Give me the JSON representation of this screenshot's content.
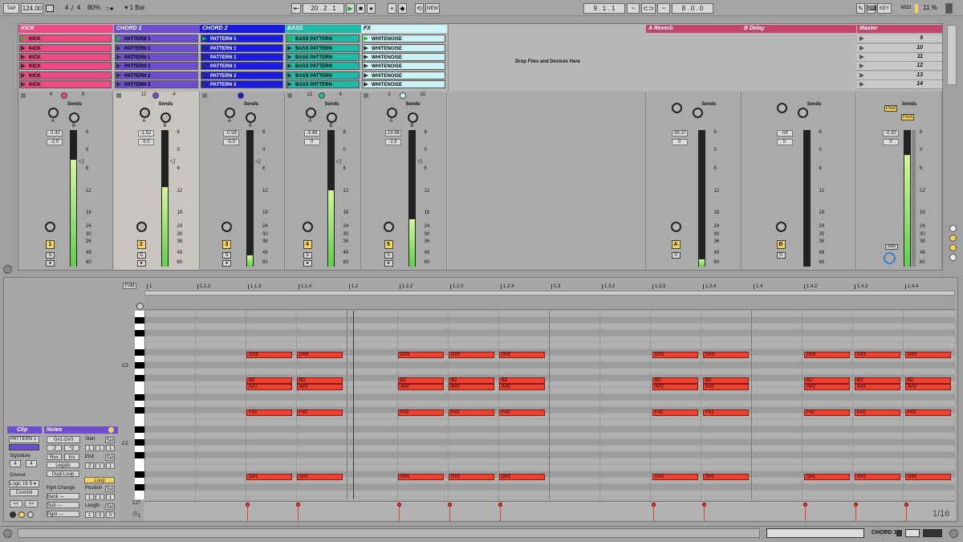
{
  "transport": {
    "tap": "TAP",
    "tempo": "124.00",
    "sig_num": "4",
    "sig_den": "4",
    "zoom": "80%",
    "quant": "1 Bar",
    "position": "20 . 2 . 1",
    "new": "NEW",
    "loop_start": "9 . 1 . 1",
    "loop_len": "8 . 0 . 0",
    "key": "KEY",
    "midi": "MIDI",
    "cpu": "11 %"
  },
  "tracks": [
    {
      "name": "KICK",
      "color": "#f04a86",
      "clips": [
        "KICK",
        "KICK",
        "KICK",
        "KICK",
        "KICK",
        "KICK"
      ],
      "n1": "6",
      "n2": "8",
      "vol": "-3.42",
      "pan": "-2.0",
      "num": "1",
      "meter": 0.78
    },
    {
      "name": "CHORD 1",
      "color": "#6e4ed0",
      "clips": [
        "PATTERN 1",
        "PATTERN 1",
        "PATTERN 1",
        "PATTERN 1",
        "PATTERN 2",
        "PATTERN 2"
      ],
      "n1": "12",
      "n2": "4",
      "vol": "-1.52",
      "pan": "-5.0",
      "num": "2",
      "meter": 0.58
    },
    {
      "name": "CHORD 2",
      "color": "#1a1ae0",
      "clips": [
        "PATTERN 1",
        "PATTERN 1",
        "PATTERN 1",
        "PATTERN 1",
        "PATTERN 2",
        "PATTERN 2"
      ],
      "n1": "",
      "n2": "",
      "vol": "-0.58",
      "pan": "-5.0",
      "num": "3",
      "meter": 0.08
    },
    {
      "name": "BASS",
      "color": "#1fb9a8",
      "clips": [
        "BASS PATTERN",
        "BASS PATTERN",
        "BASS PATTERN",
        "BASS PATTERN",
        "BASS PATTERN",
        "BASS PATTERN"
      ],
      "n1": "12",
      "n2": "4",
      "vol": "-3.48",
      "pan": "0",
      "num": "4",
      "meter": 0.56
    },
    {
      "name": "FX",
      "color": "#cdf3f7",
      "clips": [
        "WHITENOISE",
        "WHITENOISE",
        "WHITENOISE",
        "WHITENOISE",
        "WHITENOISE",
        "WHITENOISE"
      ],
      "n1": "2",
      "n2": "32",
      "vol": "-19.66",
      "pan": "-2.5",
      "num": "5",
      "meter": 0.35
    }
  ],
  "drop_zone": "Drop Files and Devices Here",
  "returns": [
    {
      "name": "A Reverb",
      "vol": "-39.37",
      "pan": "0",
      "num": "A",
      "meter": 0.05
    },
    {
      "name": "B Delay",
      "vol": "-Inf",
      "pan": "0",
      "num": "B",
      "meter": 0.0
    }
  ],
  "master": {
    "name": "Master",
    "scenes": [
      "9",
      "10",
      "11",
      "12",
      "13",
      "14"
    ],
    "vol": "-0.30",
    "pan": "0",
    "post1": "Post",
    "post2": "Post",
    "solo": "Solo",
    "meter": 0.82
  },
  "sends_label": "Sends",
  "send_a": "A",
  "send_b": "B",
  "s_label": "S",
  "meter_ticks": [
    "6",
    "0",
    "6",
    "12",
    "18",
    "24",
    "30",
    "36",
    "48",
    "60"
  ],
  "clip_panel": {
    "title": "Clip",
    "name": "PATTERN 1",
    "signature": "Signature",
    "sig_num": "4",
    "sig_den": "4",
    "groove": "Groove",
    "groove_val": "Logic 16 S",
    "commit": "Commit",
    "nav_left": "<<",
    "nav_right": ">>"
  },
  "notes_panel": {
    "title": "Notes",
    "range": "G#1-D#3",
    "half": ":2",
    "dbl": "*2",
    "rev": "Rev",
    "inv": "Inv",
    "legato": "Legato",
    "dupl": "Dupl.Loop",
    "pgm_change": "Pgm Change",
    "bank": "Bank ---",
    "sub": "Sub ---",
    "pgm": "Pgm ---",
    "start": "Start",
    "end": "End",
    "loop": "Loop",
    "position": "Position",
    "length": "Length",
    "set": "Set",
    "start_vals": [
      "1",
      "1",
      "1"
    ],
    "end_vals": [
      "2",
      "1",
      "1"
    ],
    "pos_vals": [
      "1",
      "1",
      "1"
    ],
    "len_vals": [
      "1",
      "0",
      "0"
    ]
  },
  "editor": {
    "fold": "Fold",
    "c3": "C3",
    "c2": "C2",
    "vel_max": "127",
    "vel_min": "1",
    "grid": "1/16"
  },
  "ruler": [
    "1",
    "1.1.2",
    "1.1.3",
    "1.1.4",
    "1.2",
    "1.2.2",
    "1.2.3",
    "1.2.4",
    "1.3",
    "1.3.2",
    "1.3.3",
    "1.3.4",
    "1.4",
    "1.4.2",
    "1.4.3",
    "1.4.4"
  ],
  "note_names": {
    "ds3": "D#3",
    "b2": "B2",
    "as2": "A#2",
    "fs2": "F#2",
    "gs1": "G#1"
  },
  "statusbar": {
    "track": "CHORD 1"
  }
}
